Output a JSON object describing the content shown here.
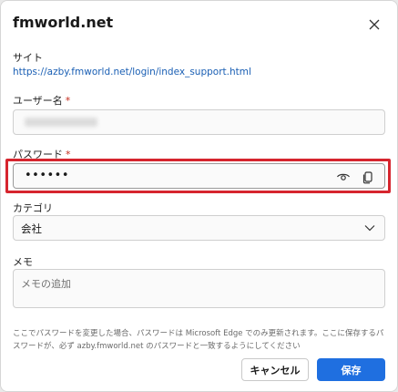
{
  "dialog": {
    "title": "fmworld.net",
    "close_icon": "close-icon"
  },
  "site": {
    "label": "サイト",
    "url": "https://azby.fmworld.net/login/index_support.html"
  },
  "username": {
    "label": "ユーザー名",
    "required_mark": "*"
  },
  "password": {
    "label": "パスワード",
    "required_mark": "*",
    "value": "••••••",
    "show_icon": "eye-icon",
    "copy_icon": "copy-icon",
    "highlight_color": "#d6252e"
  },
  "category": {
    "label": "カテゴリ",
    "selected": "会社",
    "chevron_icon": "chevron-down-icon"
  },
  "memo": {
    "label": "メモ",
    "placeholder": "メモの追加"
  },
  "notice": {
    "text": "ここでパスワードを変更した場合、パスワードは Microsoft Edge でのみ更新されます。ここに保存するパスワードが、必ず azby.fmworld.net のパスワードと一致するようにしてください"
  },
  "buttons": {
    "cancel": "キャンセル",
    "save": "保存"
  },
  "colors": {
    "accent": "#1f6fe0",
    "link": "#1a5fb4",
    "required": "#c42b1c"
  }
}
